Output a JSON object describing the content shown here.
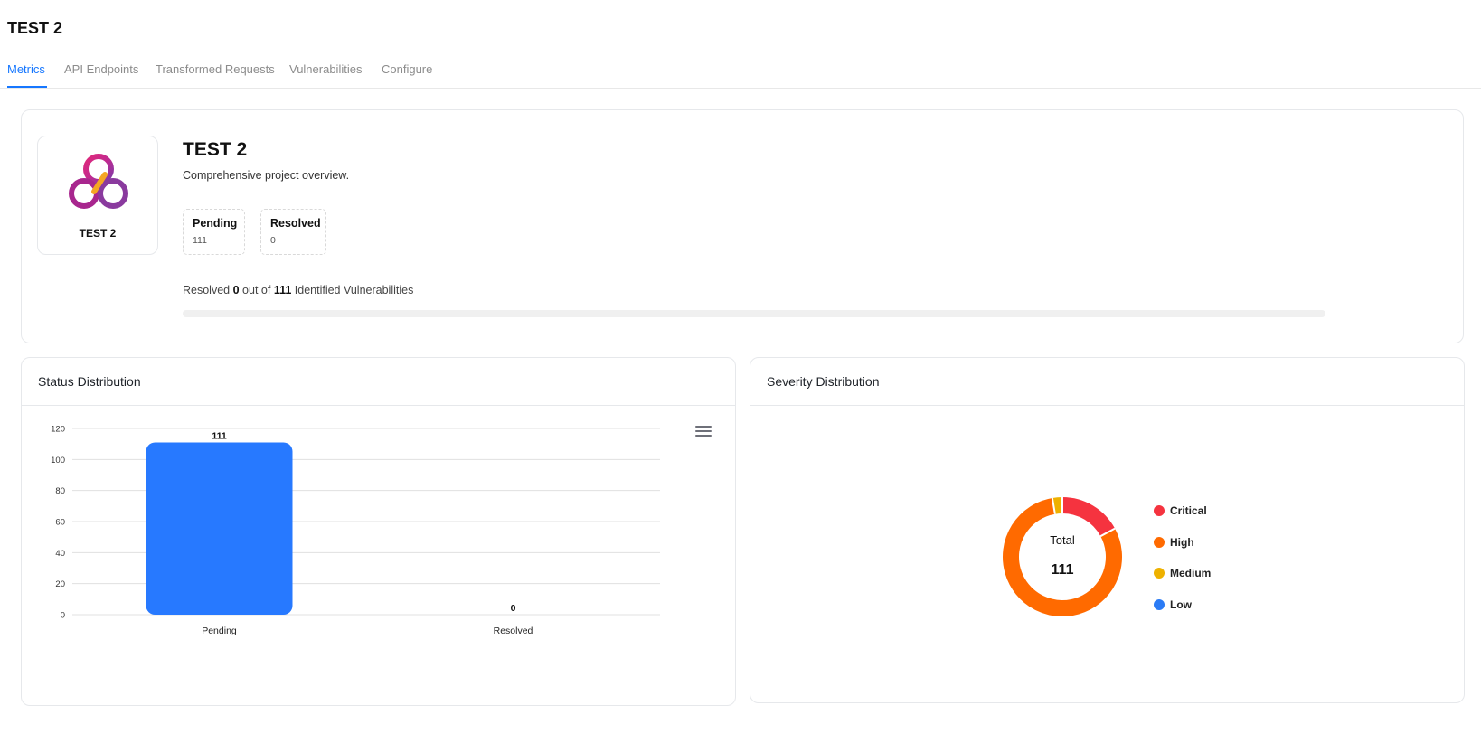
{
  "page": {
    "title": "TEST 2"
  },
  "tabs": [
    {
      "label": "Metrics",
      "active": true
    },
    {
      "label": "API Endpoints",
      "active": false
    },
    {
      "label": "Transformed Requests",
      "active": false
    },
    {
      "label": "Vulnerabilities",
      "active": false
    },
    {
      "label": "Configure",
      "active": false
    }
  ],
  "overview": {
    "logo_name": "TEST 2",
    "title": "TEST 2",
    "description": "Comprehensive project overview.",
    "stats": [
      {
        "label": "Pending",
        "value": "111"
      },
      {
        "label": "Resolved",
        "value": "0"
      }
    ],
    "resolved_prefix": "Resolved",
    "resolved_count": "0",
    "resolved_mid": "out of",
    "total_count": "111",
    "resolved_suffix": "Identified Vulnerabilities",
    "progress_fraction": 0
  },
  "status_panel": {
    "title": "Status Distribution"
  },
  "severity_panel": {
    "title": "Severity Distribution",
    "center_label": "Total",
    "center_value": "111"
  },
  "colors": {
    "accent": "#1677ff",
    "bar": "#2779ff",
    "critical": "#f5333f",
    "high": "#ff6a00",
    "medium": "#eeb100",
    "low": "#2b7bf5"
  },
  "icons": {
    "menu": "hamburger-menu-icon",
    "logo": "trefoil-knot-logo"
  },
  "chart_data": [
    {
      "type": "bar",
      "categories": [
        "Pending",
        "Resolved"
      ],
      "values": [
        111,
        0
      ],
      "data_labels": [
        "111",
        "0"
      ],
      "ylim": [
        0,
        120
      ],
      "yticks": [
        0,
        20,
        40,
        60,
        80,
        100,
        120
      ],
      "grid": true
    },
    {
      "type": "pie",
      "donut": true,
      "labels": [
        "Critical",
        "High",
        "Medium",
        "Low"
      ],
      "values": [
        19,
        89,
        3,
        0
      ],
      "legend": "right"
    }
  ]
}
